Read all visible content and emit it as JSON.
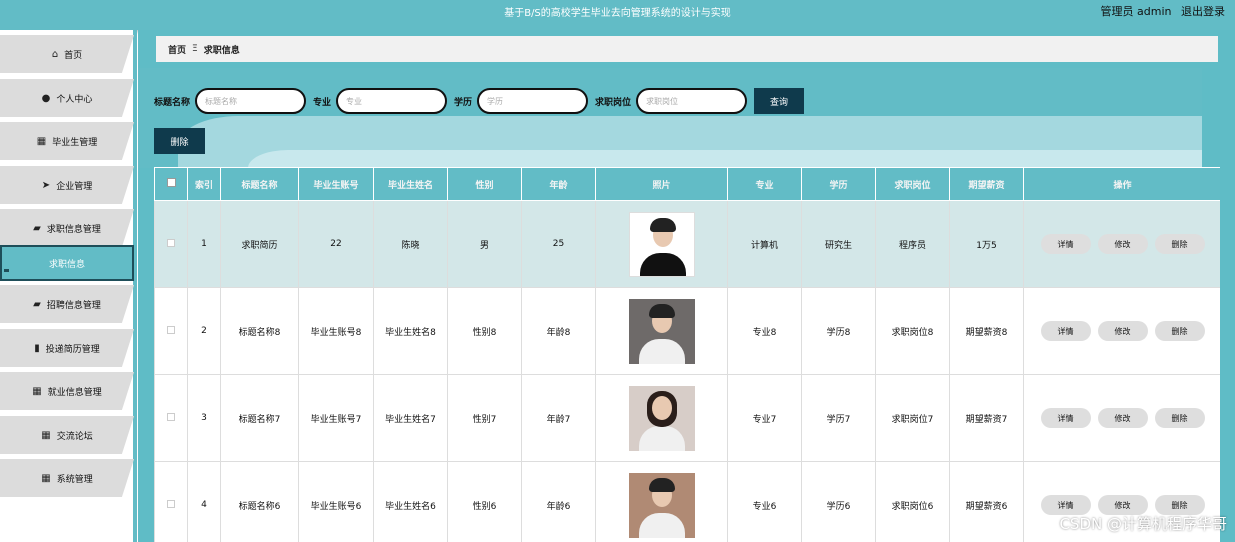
{
  "header": {
    "title": "基于B/S的高校学生毕业去向管理系统的设计与实现",
    "user_label": "管理员 admin",
    "logout_label": "退出登录"
  },
  "sidebar": {
    "items": [
      {
        "label": "首页",
        "icon": "home-icon"
      },
      {
        "label": "个人中心",
        "icon": "user-icon"
      },
      {
        "label": "毕业生管理",
        "icon": "grid-icon"
      },
      {
        "label": "企业管理",
        "icon": "send-icon"
      },
      {
        "label": "求职信息管理",
        "icon": "briefcase-icon"
      },
      {
        "label": "招聘信息管理",
        "icon": "briefcase-icon"
      },
      {
        "label": "投递简历管理",
        "icon": "bar-chart-icon"
      },
      {
        "label": "就业信息管理",
        "icon": "grid-icon"
      },
      {
        "label": "交流论坛",
        "icon": "grid-icon"
      },
      {
        "label": "系统管理",
        "icon": "grid-icon"
      }
    ],
    "active_sub": "求职信息"
  },
  "breadcrumb": {
    "home": "首页",
    "separator": "Ξ",
    "current": "求职信息"
  },
  "search": {
    "fields": [
      {
        "label": "标题名称",
        "placeholder": "标题名称"
      },
      {
        "label": "专业",
        "placeholder": "专业"
      },
      {
        "label": "学历",
        "placeholder": "学历"
      },
      {
        "label": "求职岗位",
        "placeholder": "求职岗位"
      }
    ],
    "query_button": "查询"
  },
  "delete_button": "删除",
  "table": {
    "headers": [
      "索引",
      "标题名称",
      "毕业生账号",
      "毕业生姓名",
      "性别",
      "年龄",
      "照片",
      "专业",
      "学历",
      "求职岗位",
      "期望薪资",
      "操作"
    ],
    "rows": [
      {
        "index": "1",
        "title": "求职简历",
        "account": "22",
        "name": "陈晓",
        "gender": "男",
        "age": "25",
        "major": "计算机",
        "degree": "研究生",
        "position": "程序员",
        "salary": "1万5"
      },
      {
        "index": "2",
        "title": "标题名称8",
        "account": "毕业生账号8",
        "name": "毕业生姓名8",
        "gender": "性别8",
        "age": "年龄8",
        "major": "专业8",
        "degree": "学历8",
        "position": "求职岗位8",
        "salary": "期望薪资8"
      },
      {
        "index": "3",
        "title": "标题名称7",
        "account": "毕业生账号7",
        "name": "毕业生姓名7",
        "gender": "性别7",
        "age": "年龄7",
        "major": "专业7",
        "degree": "学历7",
        "position": "求职岗位7",
        "salary": "期望薪资7"
      },
      {
        "index": "4",
        "title": "标题名称6",
        "account": "毕业生账号6",
        "name": "毕业生姓名6",
        "gender": "性别6",
        "age": "年龄6",
        "major": "专业6",
        "degree": "学历6",
        "position": "求职岗位6",
        "salary": "期望薪资6"
      }
    ],
    "actions": {
      "detail": "详情",
      "edit": "修改",
      "delete": "删除"
    }
  },
  "watermark": "CSDN @计算机程序华哥",
  "colors": {
    "accent": "#62bcc6",
    "dark": "#0f3a4c",
    "selected_row": "#d3e7e8"
  }
}
